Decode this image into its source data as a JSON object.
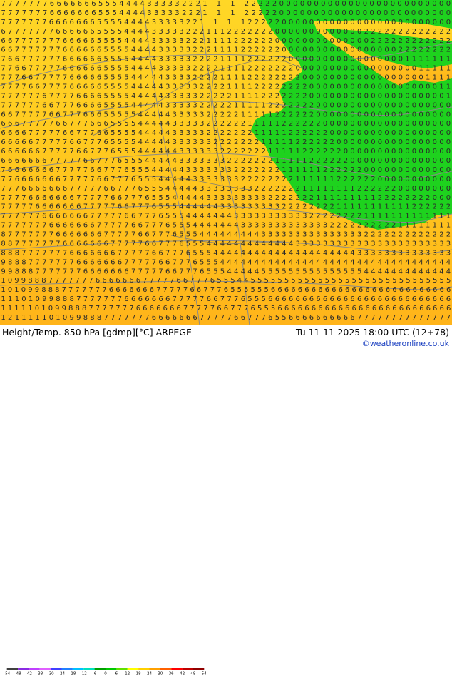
{
  "footer": {
    "title": "Height/Temp. 850 hPa [gdmp][°C] ARPEGE",
    "timestamp": "Tu 11-11-2025 18:00 UTC (12+78)",
    "credit": "©weatheronline.co.uk"
  },
  "colorbar": {
    "labels": [
      "-54",
      "-48",
      "-42",
      "-38",
      "-30",
      "-24",
      "-18",
      "-12",
      "-6",
      "0",
      "6",
      "12",
      "18",
      "24",
      "30",
      "36",
      "42",
      "48",
      "54"
    ],
    "colors": [
      "#404040",
      "#8a2be2",
      "#c040ff",
      "#e060ff",
      "#4040ff",
      "#2080ff",
      "#00c0ff",
      "#00e0c0",
      "#00a000",
      "#00c800",
      "#60e000",
      "#ffff00",
      "#ffd000",
      "#ffa000",
      "#ff6000",
      "#ff0000",
      "#c00000",
      "#900000"
    ]
  },
  "map": {
    "colors": {
      "land_green": "#1ed21e",
      "warm_1": "#ffd726",
      "warm_2": "#ffc61e",
      "warm_3": "#ffb41a",
      "contour": "#8a8a8a"
    },
    "temperature_grid": [
      "777777766666665554444333332221 1 1 222220000000000000000000000000",
      "777777766666665554444333332221 1 1 222220000000000000000000000000",
      "777777766666665555444433333221 1 1 1222220000000000000000000000000",
      "677777776666665555444433333222111222222200000000000002222222222222",
      "667777777666665555444433333222111122222200000000000000222222222222",
      "667777777666666555544443333322211112222220000000000000000022222222",
      "766777777666666555544443333322221111222222000000000000000001111111",
      "776677777666666555544443333322221111222222200000000000000000011111",
      "777667777766666555544444333322221111222222220000000000000000001111",
      "777766777766666555544444333332222111122222222000000000000000000011",
      "777777677776666555544444333332222211112222222000000000000000000001",
      "777777667776666555544444333332222211111222222200000000000000000000",
      "667777766777666555554444433333222221111122222200000000000000000000",
      "666777776677766655554444433333222222111112222220000000000000000000",
      "666677777667776655554444433333222222211111222222000000000000000000",
      "666667777766777655554444433333322222221111122222200000000000000000",
      "666666777776677765554444443333332222222111112222220000000000000000",
      "666666677777667776555444443333333222222211111222222000000000000000",
      "766666667777766777655544444333333322222221111112222220000000000000",
      "776666666777776677765554444433333332222222211111122222200000000000",
      "777666666677777667776555444443333333322222221111111122222200000000",
      "777766666667777766777655544444333333333222222211111111122222222000",
      "777776666666777776677765554444443333333332222222211111111111222222",
      "777777666666677777667776555444444433333333333222222221111111111111",
      "777777766666667777766777655544444443333333333333222222222211111111",
      "877777776666666777776677765554444444443333333333333332222222222222",
      "887777777666666677777667776555444444444444433333333333333333333333",
      "888777777766666667777766777655544444444444444444444433333333333333",
      "988877777776666666777776677765554444444444444444444444444444444444",
      "998887777777666666677777667776555444445555555555555554444444444444",
      "1099888777777766666667777766777655544555555555555555555555555555555",
      "1010998887777777666666677777667776555555666666666666666666666666666",
      "111010998887777777666666677777667776555666666666666666666666666666",
      "1111101099888777777766666667777766777655566666666666666666666666666",
      "121111101099888777777766666667777766777655666666666677777777777777"
    ]
  }
}
